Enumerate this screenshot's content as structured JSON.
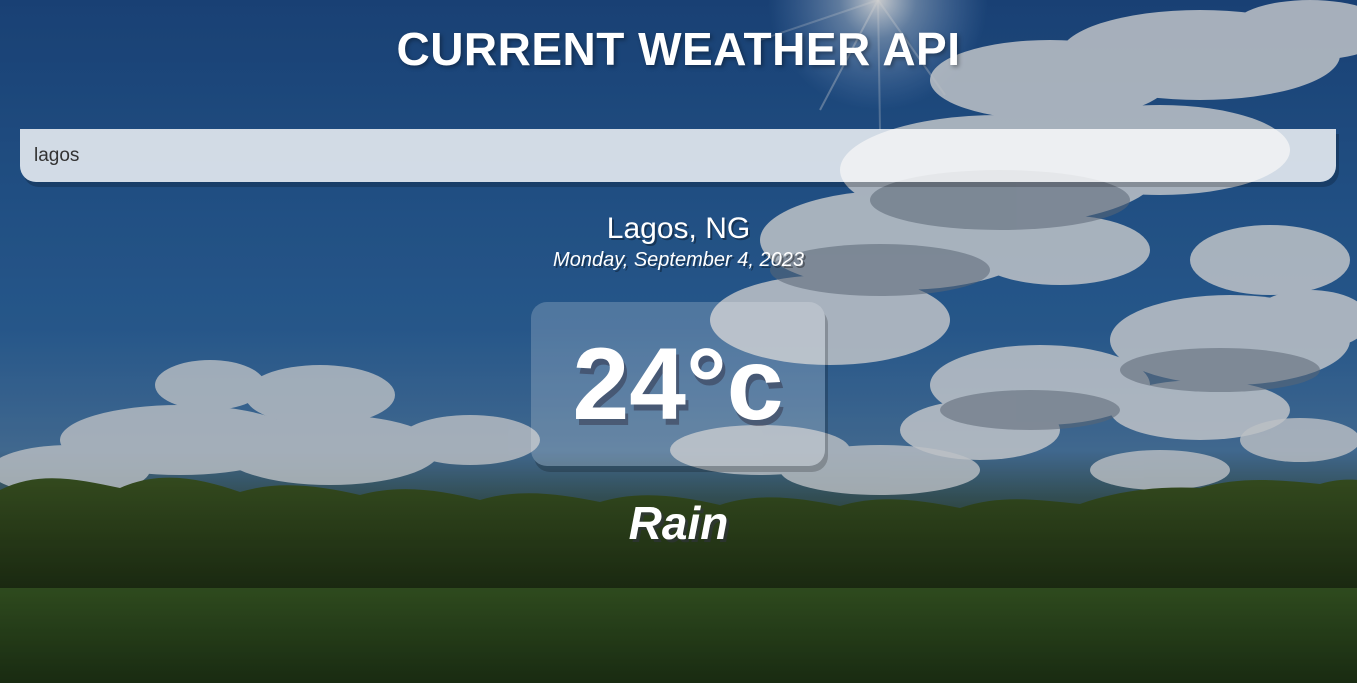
{
  "app": {
    "title": "CURRENT WEATHER API"
  },
  "search": {
    "value": "lagos"
  },
  "weather": {
    "location": "Lagos, NG",
    "date": "Monday, September 4, 2023",
    "temperature": "24°c",
    "condition": "Rain"
  },
  "colors": {
    "text": "#ffffff",
    "sky": "#28609f",
    "field": "#2d4a22"
  }
}
